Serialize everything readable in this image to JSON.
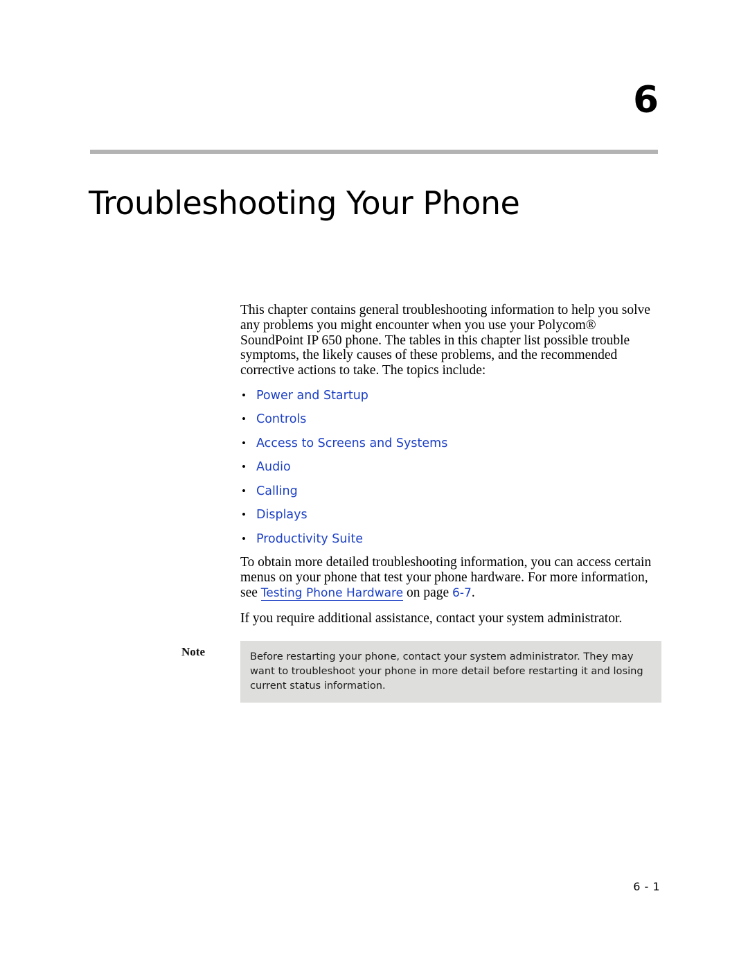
{
  "page": {
    "chapter_number": "6",
    "title": "Troubleshooting Your Phone",
    "footer": "6 - 1"
  },
  "intro": {
    "paragraph": "This chapter contains general troubleshooting information to help you solve any problems you might encounter when you use your Polycom® SoundPoint IP 650 phone. The tables in this chapter list possible trouble symptoms, the likely causes of these problems, and the recommended corrective actions to take. The topics include:"
  },
  "topics": [
    {
      "label": "Power and Startup"
    },
    {
      "label": "Controls"
    },
    {
      "label": "Access to Screens and Systems"
    },
    {
      "label": "Audio"
    },
    {
      "label": "Calling"
    },
    {
      "label": "Displays"
    },
    {
      "label": "Productivity Suite"
    }
  ],
  "detail": {
    "line1": "To obtain more detailed troubleshooting information, you can access certain",
    "line2": "menus on your phone that test your phone hardware. For more information,",
    "line3_prefix": "see ",
    "link_text": "Testing Phone Hardware",
    "line3_mid": " on page ",
    "page_ref": "6-7",
    "line3_end": ".",
    "assistance": "If you require additional assistance, contact your system administrator."
  },
  "note": {
    "label": "Note",
    "text": "Before restarting your phone, contact your system administrator. They may want to troubleshoot your phone in more detail before restarting it and losing current status information."
  },
  "colors": {
    "link": "#1b3fc4",
    "rule": "#b3b3b3",
    "note_background": "#dededc"
  }
}
